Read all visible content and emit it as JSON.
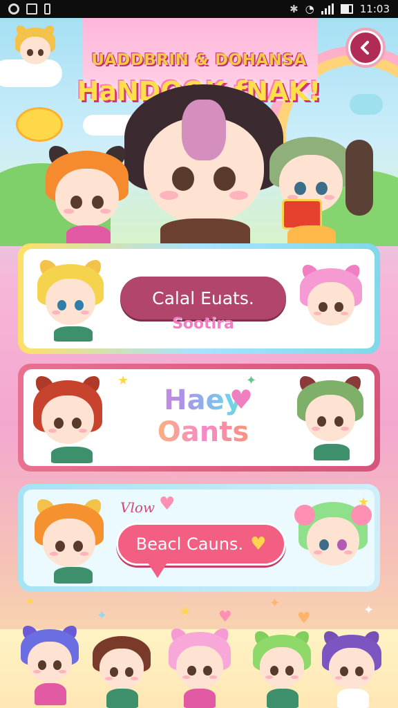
{
  "status_bar": {
    "time": "11:03",
    "icons": [
      "record-icon",
      "image-icon",
      "battery-small-icon",
      "bluetooth-icon",
      "wifi-icon",
      "signal-icon",
      "battery-icon"
    ]
  },
  "header": {
    "title_top": "UADDBRIN & DOHANSA",
    "title_main": "HaNDOOK fNAK!",
    "back_icon": "back-arrow-icon"
  },
  "cards": [
    {
      "pill_label": "Calal Euats.",
      "sub_label": "Sootira"
    },
    {
      "line1": "Haey",
      "line2": "Oants"
    },
    {
      "tag": "Vlow",
      "pill_label": "Beacl Cauns."
    }
  ],
  "colors": {
    "card1_pill": "#b1456b",
    "card2_border": "#d7547a",
    "card3_pill": "#f25f82",
    "title_fill": "#ffe04a",
    "title_outline": "#d0357e"
  }
}
